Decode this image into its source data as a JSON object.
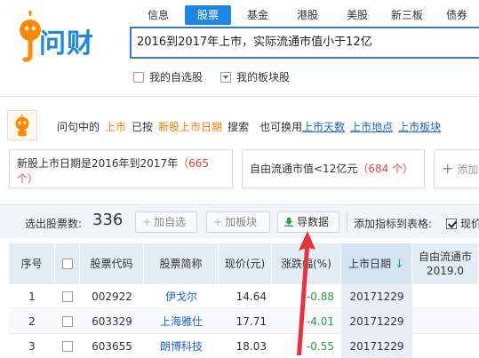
{
  "header": {
    "logo_text": "问财",
    "nav_tabs": [
      {
        "label": "信息",
        "active": false
      },
      {
        "label": "股票",
        "active": true
      },
      {
        "label": "基金",
        "active": false
      },
      {
        "label": "港股",
        "active": false
      },
      {
        "label": "美股",
        "active": false
      },
      {
        "label": "新三板",
        "active": false
      },
      {
        "label": "债券",
        "active": false
      }
    ],
    "search_query": "2016到2017年上市，实际流通市值小于12亿",
    "option_my_stocks": "我的自选股",
    "option_my_blocks": "我的板块股"
  },
  "hint": {
    "prefix": "问句中的",
    "term": "上市",
    "by": "已按",
    "interpreted": "新股上市日期",
    "search": "搜索",
    "alt_prefix": "也可换用",
    "alternatives": [
      "上市天数",
      "上市地点",
      "上市板块"
    ]
  },
  "conditions": [
    {
      "text": "新股上市日期是2016年到2017年",
      "count": "（665 个）"
    },
    {
      "text": "自由流通市值<12亿元",
      "count": "（684 个）"
    }
  ],
  "add_condition_label": "添加",
  "toolbar": {
    "selected_label": "选出股票数:",
    "selected_count": "336",
    "add_watch": "加自选",
    "add_block": "加板块",
    "export": "导数据",
    "add_indicator": "添加指标到表格:",
    "current_price": "现价"
  },
  "table": {
    "headers": [
      "序号",
      "",
      "股票代码",
      "股票简称",
      "现价(元)",
      "涨跌幅(%)",
      "上市日期",
      "自由流通市"
    ],
    "header_sub": "2019.0",
    "sort_arrow": "↓",
    "rows": [
      {
        "index": "1",
        "code": "002922",
        "name": "伊戈尔",
        "price": "14.64",
        "change": "-0.88",
        "date": "20171229"
      },
      {
        "index": "2",
        "code": "603329",
        "name": "上海雅仕",
        "price": "17.71",
        "change": "-4.01",
        "date": "20171229"
      },
      {
        "index": "3",
        "code": "603655",
        "name": "朗博科技",
        "price": "18.03",
        "change": "-0.55",
        "date": "20171229"
      }
    ]
  },
  "colors": {
    "accent": "#1e87e0",
    "orange": "#ff7a00",
    "link": "#1e64c8",
    "red": "#e0443e",
    "green": "#2ba04a",
    "annotation": "#e8323c"
  }
}
